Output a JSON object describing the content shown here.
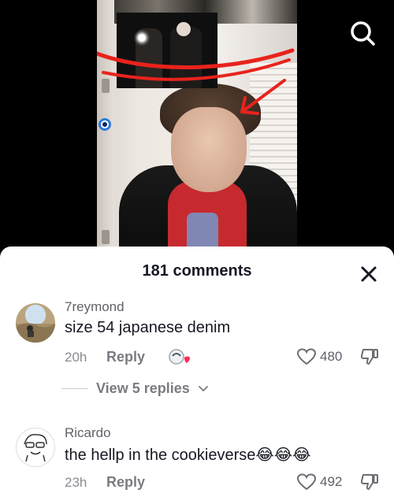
{
  "header": {
    "comments_count": "181 comments"
  },
  "icons": {
    "search": "search-icon",
    "close": "close-icon",
    "like": "heart-outline-icon",
    "dislike": "thumbs-down-icon",
    "chevron": "chevron-down-icon"
  },
  "colors": {
    "scribble": "#e8231c",
    "text_primary": "#161823",
    "text_secondary": "#8a8b91"
  },
  "comments": [
    {
      "username": "7reymond",
      "text": "size 54 japanese denim",
      "time": "20h",
      "reply_label": "Reply",
      "likes": "480",
      "view_replies": "View 5 replies"
    },
    {
      "username": "Ricardo",
      "text": "the hellp in the cookieverse😂😂😂",
      "time": "23h",
      "reply_label": "Reply",
      "likes": "492"
    }
  ]
}
